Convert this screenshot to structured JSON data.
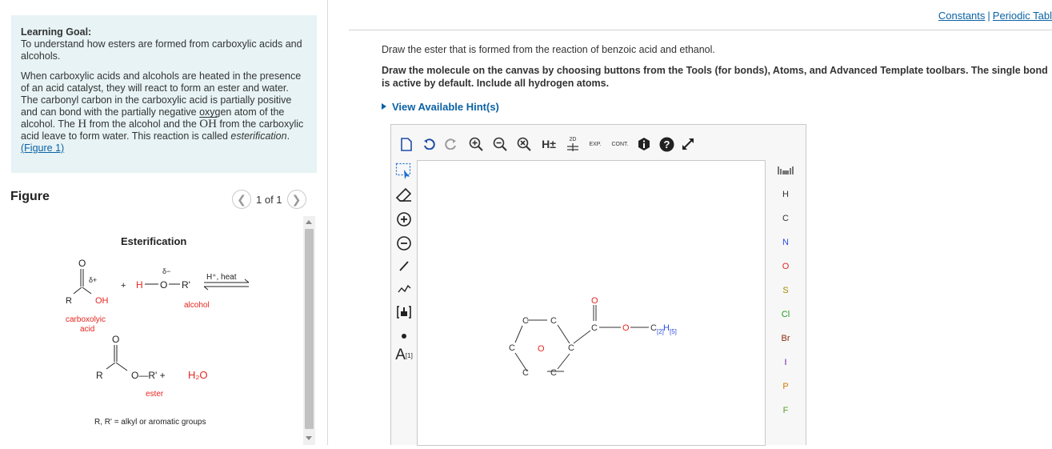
{
  "learning_goal": {
    "title": "Learning Goal:",
    "summary": "To understand how esters are formed from carboxylic acids and alcohols.",
    "p_part1": "When carboxylic acids and alcohols are heated in the presence of an acid catalyst, they will react to form an ester and water. The carbonyl carbon in the carboxylic acid is partially positive and can bond with the partially negative oxygen atom of the alcohol. The ",
    "h_symbol": "H",
    "p_part2": " from the alcohol and the ",
    "oh_symbol": "OH",
    "p_part3": " from the carboxylic acid leave to form water. This reaction is called ",
    "term": "esterification",
    "p_part4": ".",
    "figure_link": "(Figure 1)"
  },
  "figure": {
    "heading": "Figure",
    "pager_text": "1 of 1",
    "title": "Esterification",
    "delta_plus": "δ+",
    "delta_minus": "δ−",
    "acid_O": "O",
    "acid_R": "R",
    "acid_OH": "OH",
    "acid_label": "carboxolyic",
    "acid_label2": "acid",
    "plus1": "+",
    "alcohol_formula_H": "H",
    "alcohol_formula_O": "O",
    "alcohol_formula_R": "R'",
    "conditions": "H⁺, heat",
    "alcohol_label": "alcohol",
    "ester_O": "O",
    "ester_R": "R",
    "ester_chain": "O—R' +",
    "water": "H₂O",
    "ester_label": "ester",
    "footnote": "R, R' = alkyl or aromatic groups"
  },
  "header_links": {
    "constants": "Constants",
    "periodic": "Periodic Tabl"
  },
  "question": {
    "text": "Draw the ester that is formed from the reaction of benzoic acid and ethanol.",
    "instructions": "Draw the molecule on the canvas by choosing buttons from the Tools (for bonds), Atoms, and Advanced Template toolbars. The single bond is active by default. Include all hydrogen atoms.",
    "hint": "View Available Hint(s)"
  },
  "editor": {
    "top_toolbar": {
      "h_plus": "H±",
      "label_2d": "2D",
      "exp": "EXP.",
      "cont": "CONT."
    },
    "left_toolbar": {
      "charge_label": "A",
      "charge_sup": "[1]"
    },
    "atoms": [
      "H",
      "C",
      "N",
      "O",
      "S",
      "Cl",
      "Br",
      "I",
      "P",
      "F"
    ],
    "atom_colors": {
      "H": "#333333",
      "C": "#333333",
      "N": "#2f4fe0",
      "O": "#e8251f",
      "S": "#a08b00",
      "Cl": "#1d9b1d",
      "Br": "#8b2a0e",
      "I": "#6b1fa8",
      "P": "#d27a00",
      "F": "#5aa02c"
    },
    "canvas": {
      "ring_atoms": [
        "C",
        "C",
        "C",
        "C",
        "C",
        "C"
      ],
      "ring_center": "O",
      "carbonyl_O": "O",
      "carbonyl_C": "C",
      "ester_O": "O",
      "c_label": "C",
      "sub2": "[2]",
      "h_label": "H",
      "sub5": "[5]"
    }
  }
}
